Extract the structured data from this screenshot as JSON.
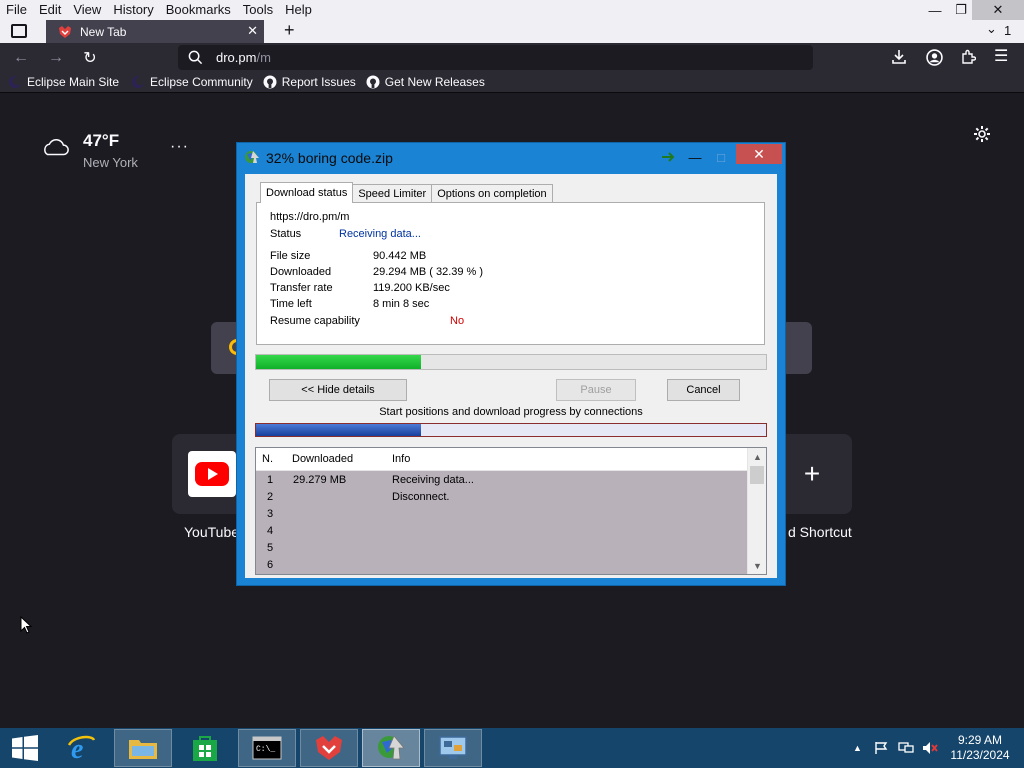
{
  "browser": {
    "menu": [
      "File",
      "Edit",
      "View",
      "History",
      "Bookmarks",
      "Tools",
      "Help"
    ],
    "tab_title": "New Tab",
    "tab_count": "1",
    "url_host": "dro.pm",
    "url_path": "/m",
    "bookmarks": [
      "Eclipse Main Site",
      "Eclipse Community",
      "Report Issues",
      "Get New Releases"
    ]
  },
  "newtab": {
    "temperature": "47°F",
    "city": "New York",
    "shortcuts": [
      "YouTube",
      "Add Shortcut"
    ],
    "shortcut_label_left": "YouTube",
    "shortcut_label_right": "d Shortcut"
  },
  "dialog": {
    "title": "32% boring code.zip",
    "tabs": [
      "Download status",
      "Speed Limiter",
      "Options on completion"
    ],
    "url": "https://dro.pm/m",
    "status_label": "Status",
    "status_value": "Receiving data...",
    "rows": [
      {
        "label": "File size",
        "value": "90.442  MB"
      },
      {
        "label": "Downloaded",
        "value": "29.294  MB  ( 32.39 % )"
      },
      {
        "label": "Transfer rate",
        "value": "119.200  KB/sec"
      },
      {
        "label": "Time left",
        "value": "8 min 8 sec"
      }
    ],
    "resume_label": "Resume capability",
    "resume_value": "No",
    "progress_fraction": 0.3239,
    "hide_details": "<< Hide details",
    "pause": "Pause",
    "cancel": "Cancel",
    "connections_label": "Start positions and download progress by connections",
    "connections_progress_fraction": 0.3239,
    "columns": [
      "N.",
      "Downloaded",
      "Info"
    ],
    "connections": [
      {
        "n": "1",
        "downloaded": "29.279  MB",
        "info": "Receiving data..."
      },
      {
        "n": "2",
        "downloaded": "",
        "info": "Disconnect."
      },
      {
        "n": "3",
        "downloaded": "",
        "info": ""
      },
      {
        "n": "4",
        "downloaded": "",
        "info": ""
      },
      {
        "n": "5",
        "downloaded": "",
        "info": ""
      },
      {
        "n": "6",
        "downloaded": "",
        "info": ""
      }
    ]
  },
  "taskbar": {
    "time": "9:29 AM",
    "date": "11/23/2024"
  },
  "colors": {
    "dialog_frame": "#1a83d4",
    "progress_green": "#11b02a",
    "conn_blue": "#1a3f9c",
    "resume_no": "#d40000",
    "status_blue": "#0033a0"
  }
}
